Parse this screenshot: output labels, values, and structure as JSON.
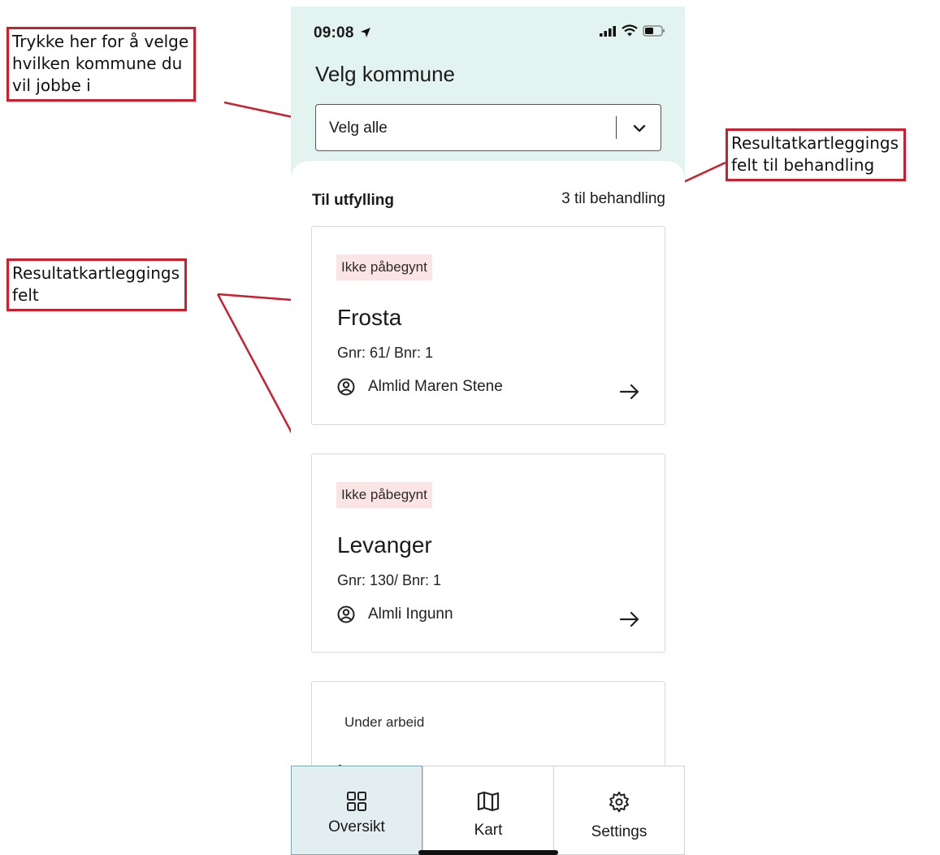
{
  "annotations": {
    "select_kommune": [
      "Trykke her for å velge",
      "hvilken kommune du",
      "vil jobbe i"
    ],
    "count_field": [
      "Resultatkartleggings",
      "felt til behandling"
    ],
    "card_field": [
      "Resultatkartleggings",
      "felt"
    ]
  },
  "status_bar": {
    "time": "09:08"
  },
  "header": {
    "title": "Velg kommune",
    "select_value": "Velg alle"
  },
  "section": {
    "title": "Til utfylling",
    "count": "3 til behandling"
  },
  "cards": [
    {
      "status": "Ikke påbegynt",
      "title": "Frosta",
      "sub": "Gnr: 61/ Bnr: 1",
      "person": "Almlid Maren Stene"
    },
    {
      "status": "Ikke påbegynt",
      "title": "Levanger",
      "sub": "Gnr: 130/ Bnr: 1",
      "person": "Almli Ingunn"
    },
    {
      "status": "Under arbeid",
      "title": "Levanger"
    }
  ],
  "tabs": [
    {
      "label": "Oversikt",
      "icon": "grid-icon",
      "active": true
    },
    {
      "label": "Kart",
      "icon": "map-icon",
      "active": false
    },
    {
      "label": "Settings",
      "icon": "gear-icon",
      "active": false
    }
  ],
  "colors": {
    "accent_bg": "#e3f3ef",
    "annotation": "#c8202e",
    "badge_bg": "#fbe5e4",
    "active_tab": "#e2eef0"
  }
}
